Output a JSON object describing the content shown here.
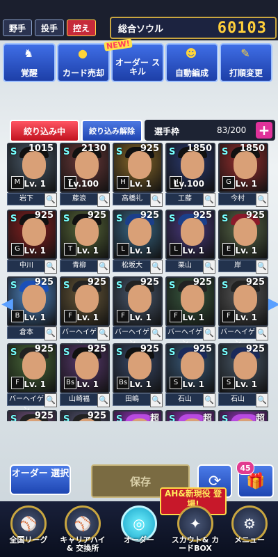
{
  "tabs": [
    {
      "label": "野手"
    },
    {
      "label": "投手"
    },
    {
      "label": "控え"
    }
  ],
  "soul": {
    "label": "総合ソウル",
    "value": "60103"
  },
  "menu": {
    "new_badge": "NEW!",
    "items": [
      {
        "label": "覚醒",
        "icon": "awaken-icon"
      },
      {
        "label": "カード売却",
        "icon": "coin-icon"
      },
      {
        "label": "オーダー スキル",
        "icon": "order-skill-icon"
      },
      {
        "label": "自動編成",
        "icon": "auto-form-icon"
      },
      {
        "label": "打順変更",
        "icon": "batting-order-icon"
      }
    ]
  },
  "filter": {
    "active_label": "絞り込み中",
    "clear_label": "絞り込み解除"
  },
  "slots": {
    "label": "選手枠",
    "count": "83/200",
    "plus": "+"
  },
  "cards": [
    {
      "name": "岩下",
      "cost": "1015",
      "lv": "Lv. 1",
      "team": "M",
      "color": "#4a5a6a",
      "cap": "#111"
    },
    {
      "name": "藤浪",
      "cost": "2130",
      "lv": "Lv.100",
      "team": "T",
      "color": "#6e3a3a",
      "cap": "#111"
    },
    {
      "name": "高橋礼",
      "cost": "925",
      "lv": "Lv. 1",
      "team": "H",
      "color": "#8a6a2a",
      "cap": "#111"
    },
    {
      "name": "工藤",
      "cost": "1850",
      "lv": "Lv.100",
      "team": "H",
      "color": "#2b3a70",
      "cap": "#111"
    },
    {
      "name": "今村",
      "cost": "1850",
      "lv": "Lv. 1",
      "team": "G",
      "color": "#9a2f2f",
      "cap": "#111"
    },
    {
      "name": "中川",
      "cost": "925",
      "lv": "Lv. 1",
      "team": "G",
      "color": "#8a2020",
      "cap": "#111"
    },
    {
      "name": "青柳",
      "cost": "925",
      "lv": "Lv. 1",
      "team": "T",
      "color": "#5a6a3a",
      "cap": "#111"
    },
    {
      "name": "松坂大",
      "cost": "925",
      "lv": "Lv. 1",
      "team": "L",
      "color": "#3a6a8a",
      "cap": "#1b3f8a"
    },
    {
      "name": "栗山",
      "cost": "925",
      "lv": "Lv. 1",
      "team": "L",
      "color": "#4a3a80",
      "cap": "#1b3f8a"
    },
    {
      "name": "岸",
      "cost": "925",
      "lv": "Lv. 1",
      "team": "E",
      "color": "#5a6a4a",
      "cap": "#8a1a2a"
    },
    {
      "name": "倉本",
      "cost": "925",
      "lv": "Lv. 1",
      "team": "B",
      "color": "#4f88c8",
      "cap": "#1b50b8"
    },
    {
      "name": "バーヘイゲン",
      "cost": "925",
      "lv": "Lv. 1",
      "team": "F",
      "color": "#6a5a3a",
      "cap": "#222"
    },
    {
      "name": "バーヘイゲン",
      "cost": "925",
      "lv": "Lv. 1",
      "team": "F",
      "color": "#4a5a70",
      "cap": "#222"
    },
    {
      "name": "バーヘイゲン",
      "cost": "925",
      "lv": "Lv. 1",
      "team": "F",
      "color": "#3a5a40",
      "cap": "#222"
    },
    {
      "name": "バーヘイゲン",
      "cost": "925",
      "lv": "Lv. 1",
      "team": "F",
      "color": "#5a5a5a",
      "cap": "#222"
    },
    {
      "name": "バーヘイゲン",
      "cost": "925",
      "lv": "Lv. 1",
      "team": "F",
      "color": "#4a6a3a",
      "cap": "#222"
    },
    {
      "name": "山崎福",
      "cost": "925",
      "lv": "Lv. 1",
      "team": "Bs",
      "color": "#5a3a70",
      "cap": "#111"
    },
    {
      "name": "田嶋",
      "cost": "925",
      "lv": "Lv. 1",
      "team": "Bs",
      "color": "#3a4a6a",
      "cap": "#111"
    },
    {
      "name": "石山",
      "cost": "925",
      "lv": "Lv. 1",
      "team": "S",
      "color": "#3a5a7a",
      "cap": "#1b2a5a"
    },
    {
      "name": "石山",
      "cost": "925",
      "lv": "Lv. 1",
      "team": "S",
      "color": "#4a5a6a",
      "cap": "#1b2a5a"
    },
    {
      "name": "",
      "cost": "925",
      "lv": "",
      "team": "",
      "color": "#7a5a8a",
      "cap": "#222"
    },
    {
      "name": "",
      "cost": "925",
      "lv": "",
      "team": "",
      "color": "#5a5a7a",
      "cap": "#222"
    },
    {
      "name": "",
      "cost": "超",
      "lv": "",
      "team": "",
      "color": "#a23ad0",
      "cap": "#b84ae0"
    },
    {
      "name": "",
      "cost": "超",
      "lv": "",
      "team": "",
      "color": "#a23ad0",
      "cap": "#b84ae0"
    },
    {
      "name": "",
      "cost": "超",
      "lv": "",
      "team": "",
      "color": "#a23ad0",
      "cap": "#b84ae0"
    }
  ],
  "bottom": {
    "order_select": "オーダー 選択",
    "save": "保存",
    "gift_count": "45",
    "banner": "AH&新現役 登場!"
  },
  "nav": [
    {
      "label": "全国リーグ",
      "icon": "league-icon"
    },
    {
      "label": "キャリアハイ& 交換所",
      "icon": "exchange-icon"
    },
    {
      "label": "オーダー",
      "icon": "order-icon"
    },
    {
      "label": "スカウト& カードBOX",
      "icon": "scout-icon"
    },
    {
      "label": "メニュー",
      "icon": "menu-gear-icon"
    }
  ]
}
